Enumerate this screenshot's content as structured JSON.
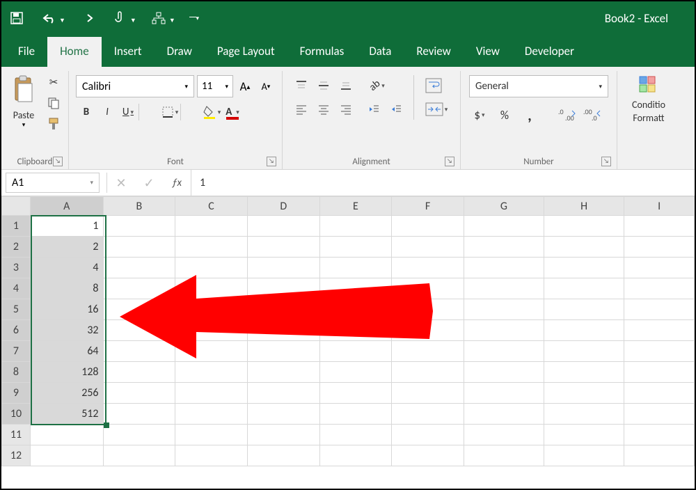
{
  "title": "Book2  -  Excel",
  "tabs": [
    "File",
    "Home",
    "Insert",
    "Draw",
    "Page Layout",
    "Formulas",
    "Data",
    "Review",
    "View",
    "Developer"
  ],
  "active_tab": 1,
  "ribbon": {
    "clipboard": {
      "paste": "Paste",
      "label": "Clipboard"
    },
    "font": {
      "name": "Calibri",
      "size": "11",
      "label": "Font"
    },
    "alignment": {
      "label": "Alignment"
    },
    "number": {
      "format": "General",
      "label": "Number"
    },
    "condfmt": {
      "line1": "Conditio",
      "line2": "Formatt"
    }
  },
  "name_box": "A1",
  "formula_value": "1",
  "columns": [
    "A",
    "B",
    "C",
    "D",
    "E",
    "F",
    "G",
    "H",
    "I"
  ],
  "rows": [
    {
      "n": "1",
      "a": "1"
    },
    {
      "n": "2",
      "a": "2"
    },
    {
      "n": "3",
      "a": "4"
    },
    {
      "n": "4",
      "a": "8"
    },
    {
      "n": "5",
      "a": "16"
    },
    {
      "n": "6",
      "a": "32"
    },
    {
      "n": "7",
      "a": "64"
    },
    {
      "n": "8",
      "a": "128"
    },
    {
      "n": "9",
      "a": "256"
    },
    {
      "n": "10",
      "a": "512"
    },
    {
      "n": "11",
      "a": ""
    },
    {
      "n": "12",
      "a": ""
    }
  ]
}
